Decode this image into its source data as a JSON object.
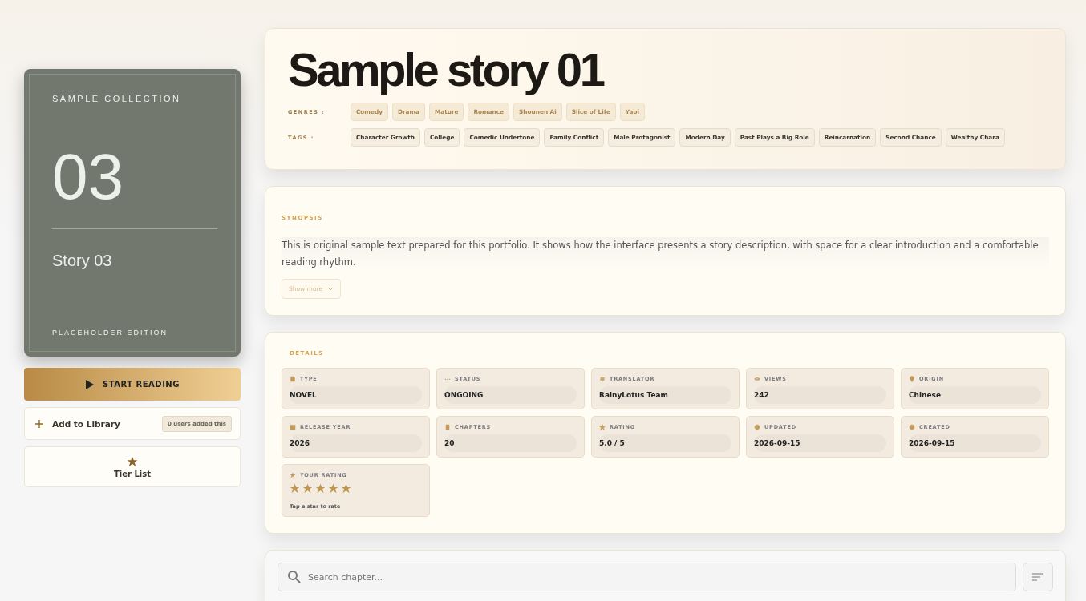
{
  "cover": {
    "collection": "SAMPLE COLLECTION",
    "number": "03",
    "story": "Story 03",
    "edition": "PLACEHOLDER EDITION"
  },
  "actions": {
    "start": "START READING",
    "library": "Add to Library",
    "library_count": "0 users added this",
    "tier": "Tier List"
  },
  "title": "Sample story 01",
  "genres": {
    "label": "GENRES :",
    "items": [
      "Comedy",
      "Drama",
      "Mature",
      "Romance",
      "Shounen Ai",
      "Slice of Life",
      "Yaoi"
    ]
  },
  "tags": {
    "label": "TAGS :",
    "items": [
      "Character Growth",
      "College",
      "Comedic Undertone",
      "Family Conflict",
      "Male Protagonist",
      "Modern Day",
      "Past Plays a Big Role",
      "Reincarnation",
      "Second Chance",
      "Wealthy Chara"
    ]
  },
  "synopsis": {
    "heading": "SYNOPSIS",
    "text": "This is original sample text prepared for this portfolio. It shows how the interface presents a story description, with space for a clear introduction and a comfortable reading rhythm.",
    "more": "Show more"
  },
  "details": {
    "heading": "DETAILS",
    "items": [
      {
        "kind": "type",
        "label": "TYPE",
        "value": "NOVEL"
      },
      {
        "kind": "status",
        "label": "STATUS",
        "value": "ONGOING"
      },
      {
        "kind": "translator",
        "label": "TRANSLATOR",
        "value": "RainyLotus Team"
      },
      {
        "kind": "views",
        "label": "VIEWS",
        "value": "242"
      },
      {
        "kind": "origin",
        "label": "ORIGIN",
        "value": "Chinese"
      },
      {
        "kind": "year",
        "label": "RELEASE YEAR",
        "value": "2026"
      },
      {
        "kind": "chapters",
        "label": "CHAPTERS",
        "value": "20"
      },
      {
        "kind": "rating",
        "label": "RATING",
        "value": "5.0 / 5"
      },
      {
        "kind": "updated",
        "label": "UPDATED",
        "value": "2026-09-15"
      },
      {
        "kind": "created",
        "label": "CREATED",
        "value": "2026-09-15"
      }
    ],
    "your_rating": {
      "label": "YOUR RATING",
      "stars": 5,
      "hint": "Tap a star to rate"
    }
  },
  "chapters": {
    "search_placeholder": "Search chapter..."
  }
}
